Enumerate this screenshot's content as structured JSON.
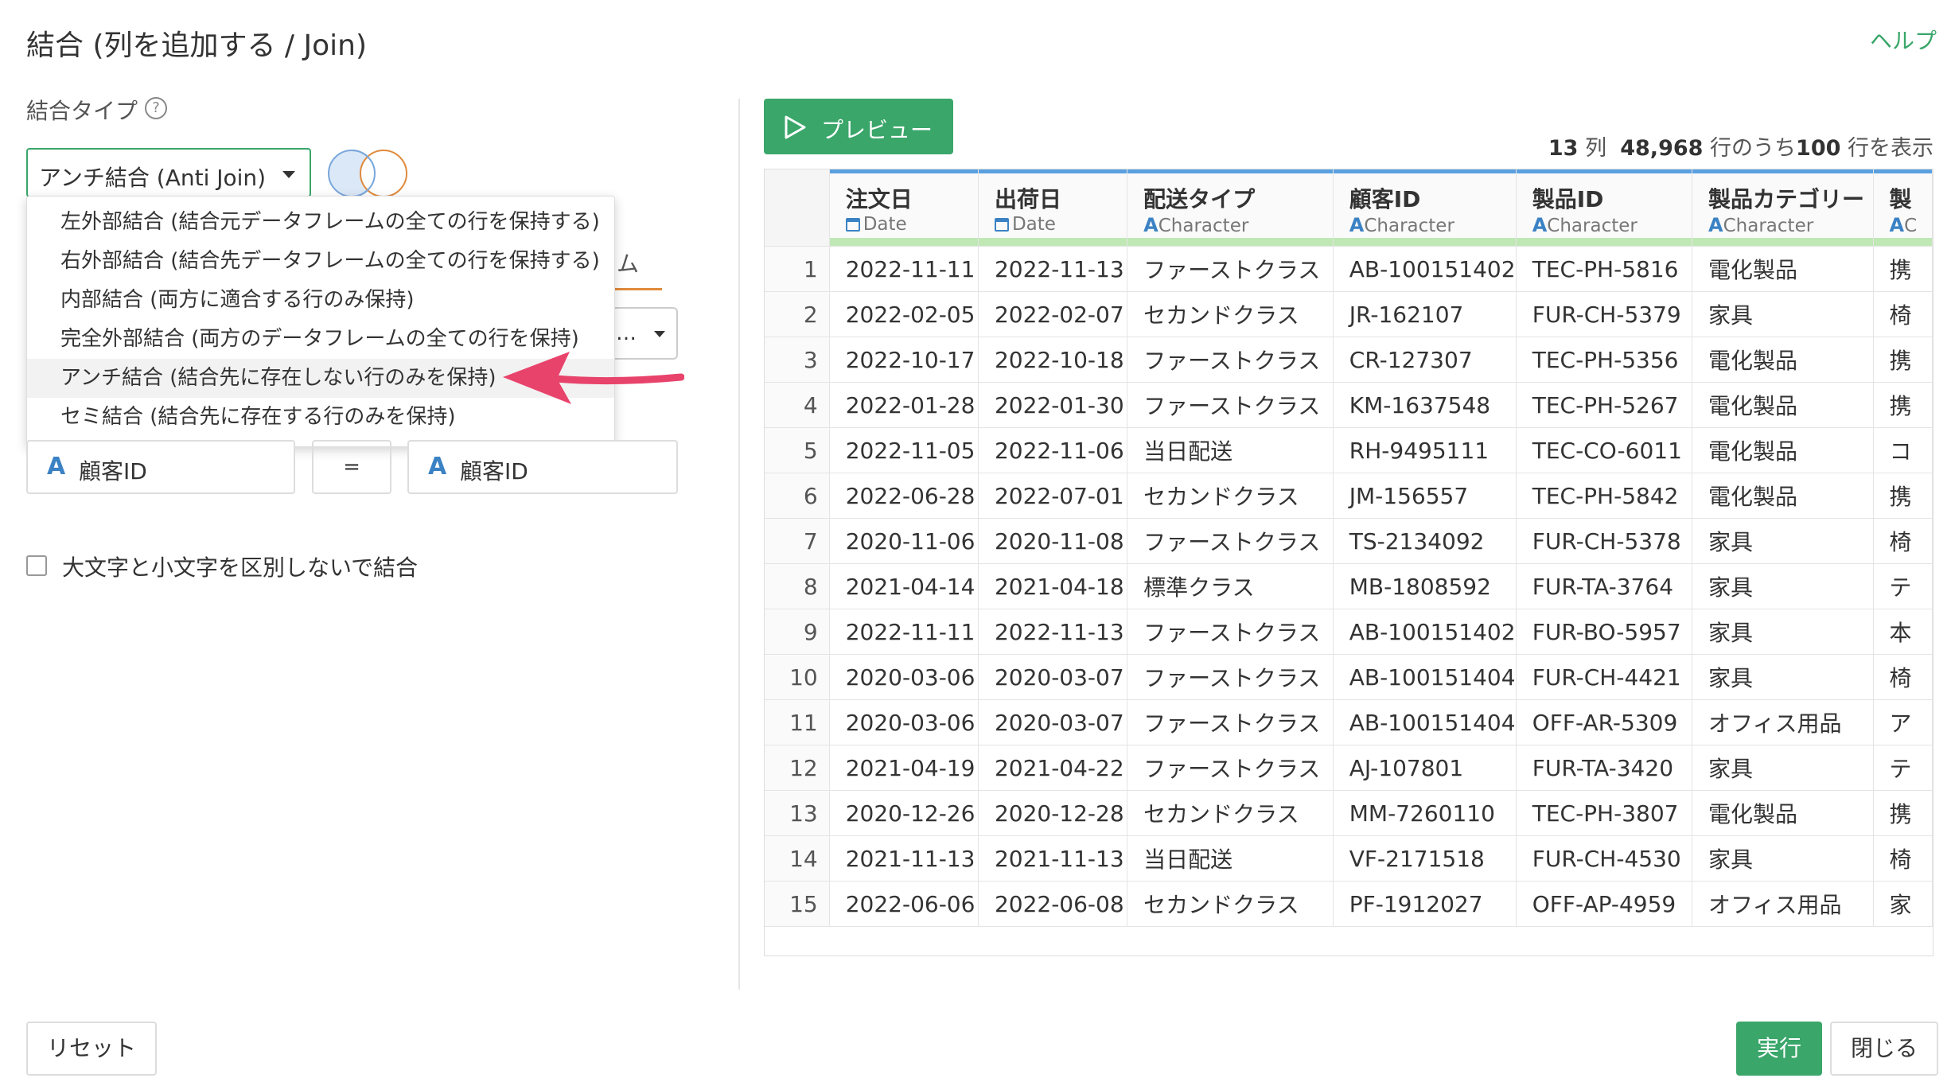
{
  "dialog": {
    "title": "結合 (列を追加する / Join)",
    "help_link": "ヘルプ"
  },
  "join_type": {
    "label": "結合タイプ",
    "help_icon": "question-circle-icon",
    "selected": "アンチ結合 (Anti Join)",
    "options": [
      "左外部結合 (結合元データフレームの全ての行を保持する)",
      "右外部結合 (結合先データフレームの全ての行を保持する)",
      "内部結合 (両方に適合する行のみ保持)",
      "完全外部結合 (両方のデータフレームの全ての行を保持)",
      "アンチ結合 (結合先に存在しない行のみを保持)",
      "セミ結合 (結合先に存在する行のみを保持)"
    ],
    "highlighted_index": 4
  },
  "background": {
    "tab_partial": "ム",
    "select_partial": "…"
  },
  "keys": {
    "left_type": "A",
    "left": "顧客ID",
    "operator": "=",
    "right_type": "A",
    "right": "顧客ID"
  },
  "case_option": {
    "label": "大文字と小文字を区別しないで結合",
    "checked": false
  },
  "preview": {
    "button_label": "プレビュー",
    "cols": "13",
    "cols_unit": "列",
    "total_rows": "48,968",
    "rows_mid": "行のうち",
    "shown_rows": "100",
    "rows_tail": "行を表示"
  },
  "grid": {
    "columns": [
      {
        "name": "注文日",
        "type": "Date"
      },
      {
        "name": "出荷日",
        "type": "Date"
      },
      {
        "name": "配送タイプ",
        "type": "Character"
      },
      {
        "name": "顧客ID",
        "type": "Character"
      },
      {
        "name": "製品ID",
        "type": "Character"
      },
      {
        "name": "製品カテゴリー",
        "type": "Character"
      },
      {
        "name": "製",
        "type": "C"
      }
    ],
    "rows": [
      [
        "1",
        "2022-11-11",
        "2022-11-13",
        "ファーストクラス",
        "AB-100151402",
        "TEC-PH-5816",
        "電化製品",
        "携"
      ],
      [
        "2",
        "2022-02-05",
        "2022-02-07",
        "セカンドクラス",
        "JR-162107",
        "FUR-CH-5379",
        "家具",
        "椅"
      ],
      [
        "3",
        "2022-10-17",
        "2022-10-18",
        "ファーストクラス",
        "CR-127307",
        "TEC-PH-5356",
        "電化製品",
        "携"
      ],
      [
        "4",
        "2022-01-28",
        "2022-01-30",
        "ファーストクラス",
        "KM-1637548",
        "TEC-PH-5267",
        "電化製品",
        "携"
      ],
      [
        "5",
        "2022-11-05",
        "2022-11-06",
        "当日配送",
        "RH-9495111",
        "TEC-CO-6011",
        "電化製品",
        "コ"
      ],
      [
        "6",
        "2022-06-28",
        "2022-07-01",
        "セカンドクラス",
        "JM-156557",
        "TEC-PH-5842",
        "電化製品",
        "携"
      ],
      [
        "7",
        "2020-11-06",
        "2020-11-08",
        "ファーストクラス",
        "TS-2134092",
        "FUR-CH-5378",
        "家具",
        "椅"
      ],
      [
        "8",
        "2021-04-14",
        "2021-04-18",
        "標準クラス",
        "MB-1808592",
        "FUR-TA-3764",
        "家具",
        "テ"
      ],
      [
        "9",
        "2022-11-11",
        "2022-11-13",
        "ファーストクラス",
        "AB-100151402",
        "FUR-BO-5957",
        "家具",
        "本"
      ],
      [
        "10",
        "2020-03-06",
        "2020-03-07",
        "ファーストクラス",
        "AB-100151404",
        "FUR-CH-4421",
        "家具",
        "椅"
      ],
      [
        "11",
        "2020-03-06",
        "2020-03-07",
        "ファーストクラス",
        "AB-100151404",
        "OFF-AR-5309",
        "オフィス用品",
        "ア"
      ],
      [
        "12",
        "2021-04-19",
        "2021-04-22",
        "ファーストクラス",
        "AJ-107801",
        "FUR-TA-3420",
        "家具",
        "テ"
      ],
      [
        "13",
        "2020-12-26",
        "2020-12-28",
        "セカンドクラス",
        "MM-7260110",
        "TEC-PH-3807",
        "電化製品",
        "携"
      ],
      [
        "14",
        "2021-11-13",
        "2021-11-13",
        "当日配送",
        "VF-2171518",
        "FUR-CH-4530",
        "家具",
        "椅"
      ],
      [
        "15",
        "2022-06-06",
        "2022-06-08",
        "セカンドクラス",
        "PF-1912027",
        "OFF-AP-4959",
        "オフィス用品",
        "家"
      ]
    ]
  },
  "footer": {
    "reset": "リセット",
    "run": "実行",
    "close": "閉じる"
  },
  "colors": {
    "accent_green": "#3aa66a",
    "highlight_arrow": "#e8436b",
    "type_blue": "#3b82c4"
  }
}
